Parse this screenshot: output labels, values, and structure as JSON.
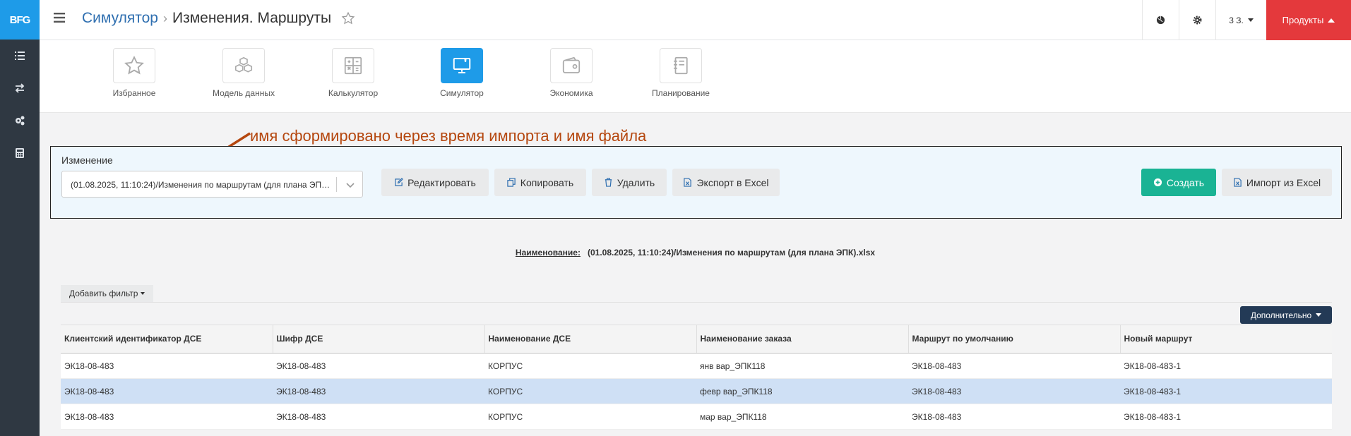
{
  "sidebar": {
    "logo": "BFG"
  },
  "topbar": {
    "breadcrumb_parent": "Симулятор",
    "breadcrumb_current": "Изменения. Маршруты",
    "user_label": "3 З.",
    "products_label": "Продукты"
  },
  "tiles": [
    {
      "label": "Избранное"
    },
    {
      "label": "Модель данных"
    },
    {
      "label": "Калькулятор"
    },
    {
      "label": "Симулятор"
    },
    {
      "label": "Экономика"
    },
    {
      "label": "Планирование"
    }
  ],
  "annotation": {
    "text": "имя сформировано через время импорта и имя файла",
    "color": "#b5470f"
  },
  "change_panel": {
    "label": "Изменение",
    "selected_value": "(01.08.2025, 11:10:24)/Изменения по маршрутам (для плана ЭПК).xlsx",
    "buttons": {
      "edit": "Редактировать",
      "copy": "Копировать",
      "delete": "Удалить",
      "export": "Экспорт в Excel",
      "create": "Создать",
      "import": "Импорт из Excel"
    }
  },
  "name_line": {
    "key": "Наименование:",
    "value": "(01.08.2025, 11:10:24)/Изменения по маршрутам (для плана ЭПК).xlsx"
  },
  "filter": {
    "add_label": "Добавить фильтр"
  },
  "more_label": "Дополнительно",
  "table": {
    "columns": [
      "Клиентский идентификатор ДСЕ",
      "Шифр ДСЕ",
      "Наименование ДСЕ",
      "Наименование заказа",
      "Маршрут по умолчанию",
      "Новый маршрут"
    ],
    "rows": [
      [
        "ЭК18-08-483",
        "ЭК18-08-483",
        "КОРПУС",
        "янв вар_ЭПК118",
        "ЭК18-08-483",
        "ЭК18-08-483-1"
      ],
      [
        "ЭК18-08-483",
        "ЭК18-08-483",
        "КОРПУС",
        "февр вар_ЭПК118",
        "ЭК18-08-483",
        "ЭК18-08-483-1"
      ],
      [
        "ЭК18-08-483",
        "ЭК18-08-483",
        "КОРПУС",
        "мар вар_ЭПК118",
        "ЭК18-08-483",
        "ЭК18-08-483-1"
      ]
    ],
    "selected_row": 1
  },
  "colors": {
    "accent": "#1e9be8",
    "sidebar": "#2f3842",
    "create": "#1ab394",
    "products": "#e4393c",
    "more": "#233a56",
    "selected_row": "#cfe0f5"
  }
}
